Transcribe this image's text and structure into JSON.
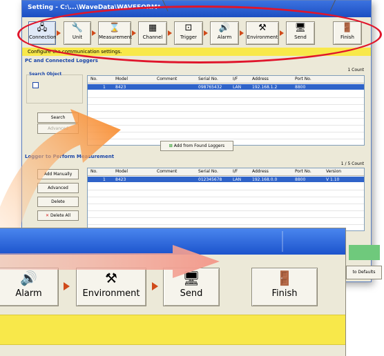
{
  "window": {
    "title": "Setting - C:\\...\\WaveData\\WAVEFORM*"
  },
  "toolbar": {
    "buttons": [
      {
        "label": "Connection",
        "icon": "network-icon",
        "glyph": "🖧"
      },
      {
        "label": "Unit",
        "icon": "wrench-icon",
        "glyph": "🔧"
      },
      {
        "label": "Measurement",
        "icon": "hourglass-icon",
        "glyph": "⌛"
      },
      {
        "label": "Channel",
        "icon": "channel-icon",
        "glyph": "▦"
      },
      {
        "label": "Trigger",
        "icon": "trigger-icon",
        "glyph": "⊡"
      },
      {
        "label": "Alarm",
        "icon": "speaker-icon",
        "glyph": "🔊"
      },
      {
        "label": "Environment",
        "icon": "tools-icon",
        "glyph": "⚒"
      },
      {
        "label": "Send",
        "icon": "computer-send-icon",
        "glyph": "🖥"
      },
      {
        "label": "Finish",
        "icon": "exit-door-icon",
        "glyph": "🚪"
      }
    ]
  },
  "banner": {
    "text": "Configure the communication settings."
  },
  "connection_section": {
    "title": "PC and Connected Loggers",
    "count": "1 Count",
    "search_object_label": "Search Object",
    "columns": [
      "No.",
      "Model",
      "Comment",
      "Serial No.",
      "I/F",
      "Address",
      "Port No."
    ],
    "row": [
      "1",
      "8423",
      "",
      "098765432",
      "LAN",
      "192.168.1.2",
      "8800"
    ],
    "search_button": "Search",
    "advanced_button": "Advanced",
    "add_found_button": "Add from Found Loggers"
  },
  "measure_section": {
    "title": "Logger to Perform Measurement",
    "count": "1 / 5 Count",
    "columns": [
      "No.",
      "Model",
      "Comment",
      "Serial No.",
      "I/F",
      "Address",
      "Port No.",
      "Version"
    ],
    "row": [
      "1",
      "8423",
      "",
      "012345678",
      "LAN",
      "192.168.0.0",
      "8800",
      "V 1.10"
    ],
    "add_manually_button": "Add Manually",
    "advanced_button": "Advanced",
    "delete_button": "Delete",
    "delete_all_button": "Delete All"
  },
  "defaults_button": "to Defaults",
  "zoom": {
    "buttons": [
      {
        "label": "Alarm",
        "icon": "speaker-icon",
        "glyph": "🔊"
      },
      {
        "label": "Environment",
        "icon": "tools-icon",
        "glyph": "⚒"
      },
      {
        "label": "Send",
        "icon": "computer-send-icon",
        "glyph": "🖥"
      },
      {
        "label": "Finish",
        "icon": "exit-door-icon",
        "glyph": "🚪"
      }
    ]
  },
  "colors": {
    "highlight": "#e0152b",
    "accent": "#d04a1a",
    "banner": "#f8e84a"
  }
}
